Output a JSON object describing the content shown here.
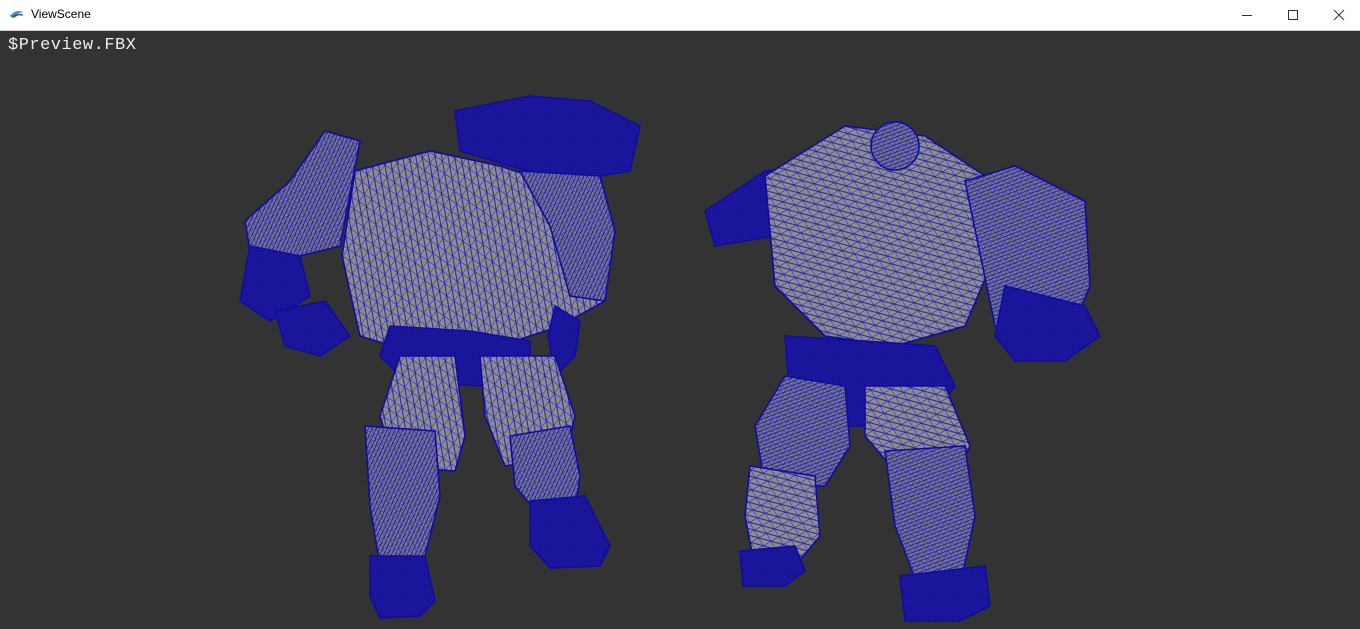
{
  "window": {
    "title": "ViewScene",
    "icon": "viewscene-app-icon",
    "controls": [
      "minimize-icon",
      "maximize-icon",
      "close-icon"
    ]
  },
  "viewport": {
    "background": "#333333",
    "overlay_label": "$Preview.FBX",
    "wire_color": "#1a14b8",
    "fill_color": "#8d8d8d",
    "models": [
      {
        "name": "mech-front-view",
        "view": "front"
      },
      {
        "name": "mech-back-view",
        "view": "back"
      }
    ]
  }
}
